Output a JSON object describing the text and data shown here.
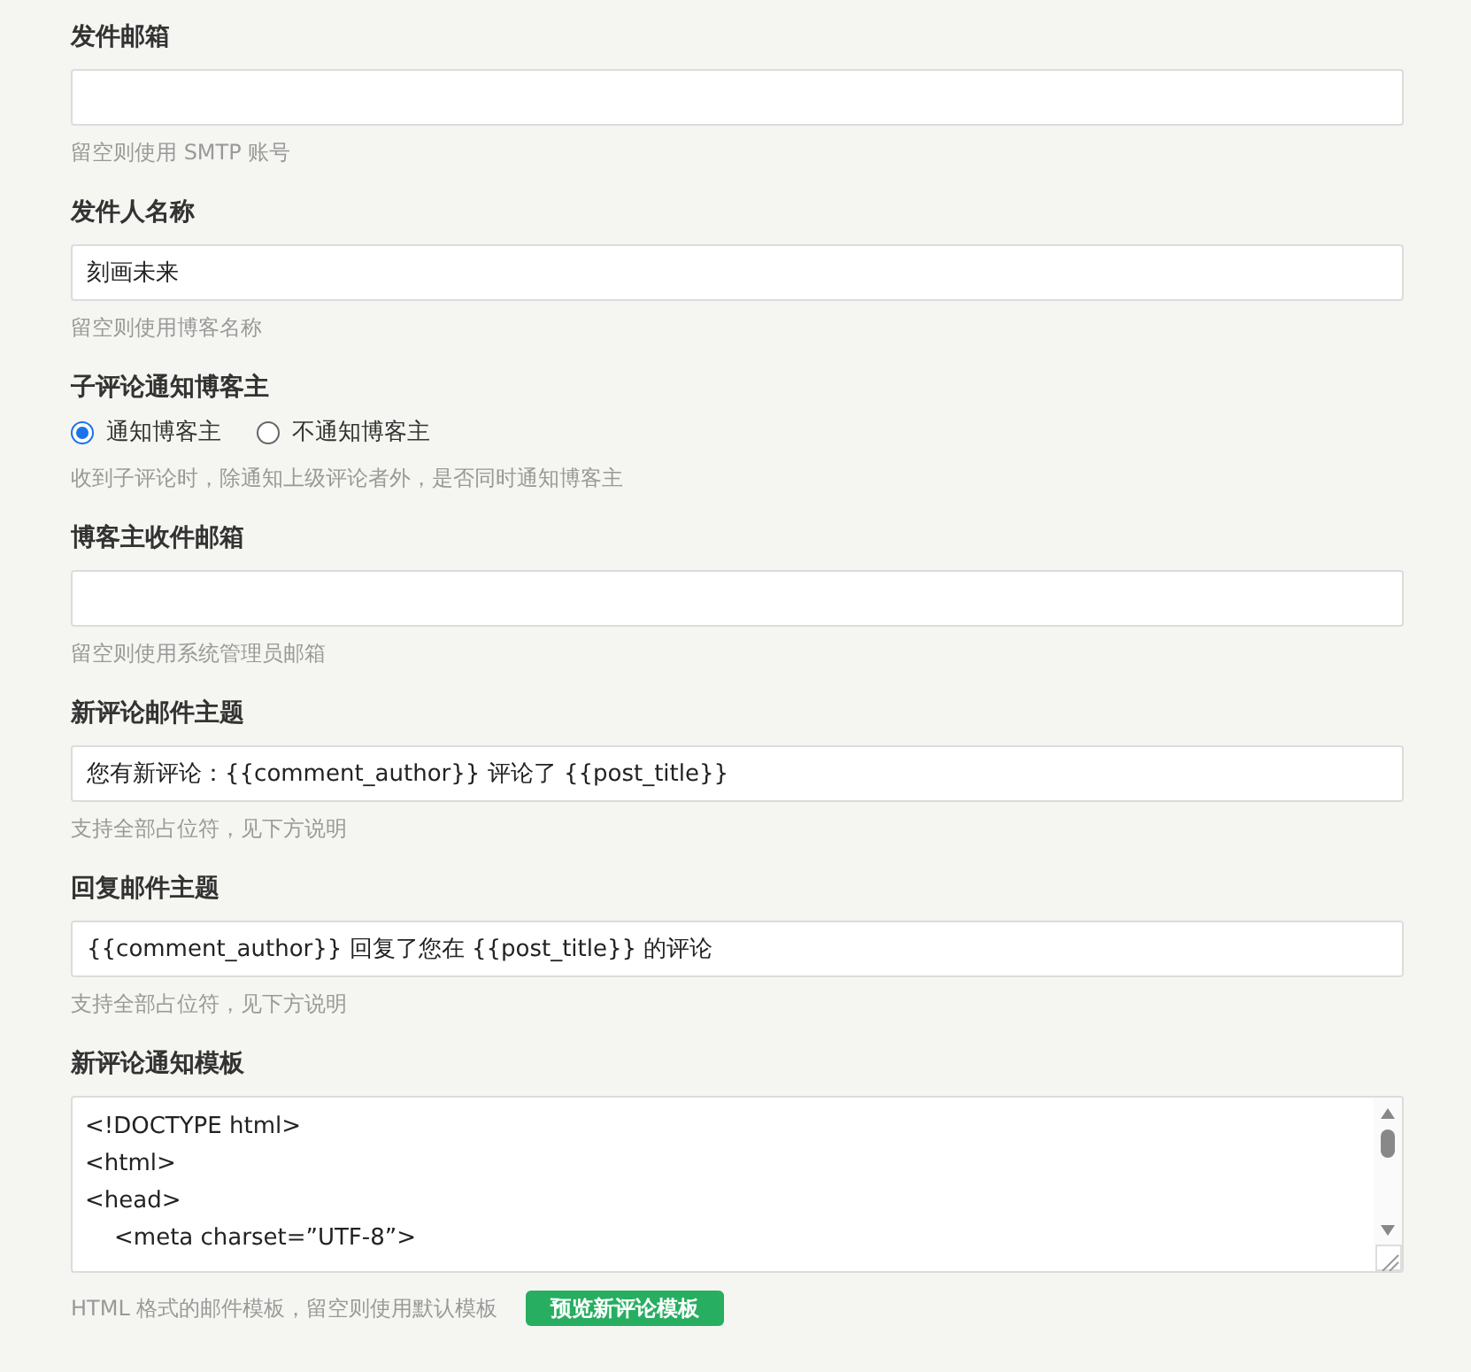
{
  "fields": [
    {
      "kind": "text",
      "label": "发件邮箱",
      "hint": "留空则使用 SMTP 账号"
    },
    {
      "kind": "text",
      "label": "发件人名称",
      "value": "刻画未来",
      "hint": "留空则使用博客名称"
    },
    {
      "kind": "radio",
      "label": "子评论通知博客主",
      "options": [
        {
          "label": "通知博客主",
          "selected": true
        },
        {
          "label": "不通知博客主",
          "selected": false
        }
      ],
      "hint": "收到子评论时，除通知上级评论者外，是否同时通知博客主"
    },
    {
      "kind": "text",
      "label": "博客主收件邮箱",
      "hint": "留空则使用系统管理员邮箱"
    },
    {
      "kind": "text",
      "label": "新评论邮件主题",
      "value": "您有新评论：{{comment_author}} 评论了 {{post_title}}",
      "hint": "支持全部占位符，见下方说明"
    },
    {
      "kind": "text",
      "label": "回复邮件主题",
      "value": "{{comment_author}} 回复了您在 {{post_title}} 的评论",
      "hint": "支持全部占位符，见下方说明"
    },
    {
      "kind": "code",
      "label": "新评论通知模板",
      "lines": [
        "<!DOCTYPE html>",
        "<html>",
        "<head>",
        "    <meta charset=”UTF-8”>"
      ],
      "hint": "HTML 格式的邮件模板，留空则使用默认模板",
      "button": "预览新评论模板"
    }
  ]
}
